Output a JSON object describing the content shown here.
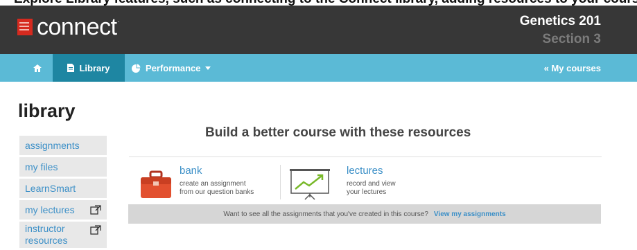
{
  "top_clip_text": "Explore Library features, such as connecting to the Connect library, adding resources to your course",
  "header": {
    "logo_text": "connect",
    "logo_tm": "·",
    "course_title": "Genetics 201",
    "course_section": "Section 3"
  },
  "nav": {
    "library_label": "Library",
    "performance_label": "Performance",
    "my_courses_label": "« My courses"
  },
  "page": {
    "title": "library"
  },
  "sidebar": {
    "items": [
      {
        "label": "assignments"
      },
      {
        "label": "my files"
      },
      {
        "label": "LearnSmart"
      },
      {
        "label": "my lectures"
      },
      {
        "label": "instructor resources"
      }
    ]
  },
  "main": {
    "heading": "Build a better course with these resources",
    "resources": [
      {
        "title": "bank",
        "desc_line1": "create an assignment",
        "desc_line2": "from our question banks"
      },
      {
        "title": "lectures",
        "desc_line1": "record and view",
        "desc_line2": "your lectures"
      }
    ],
    "footer_text": "Want to see all the assignments that you've created in this course?",
    "footer_link": "View my assignments"
  },
  "colors": {
    "header_bg": "#373737",
    "nav_bg": "#5bbad6",
    "nav_active_bg": "#1e86a2",
    "link": "#3b8fc7",
    "brand_red": "#d62a1f"
  }
}
